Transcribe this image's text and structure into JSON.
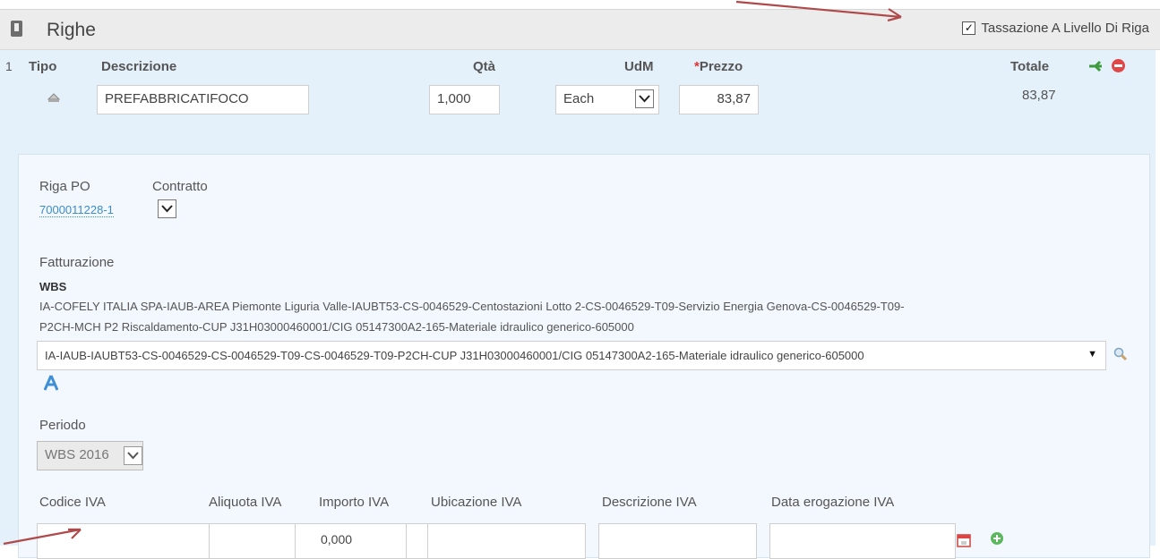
{
  "header": {
    "title": "Righe",
    "tax_label": "Tassazione A Livello Di Riga"
  },
  "line": {
    "number": "1",
    "columns": {
      "tipo": "Tipo",
      "descrizione": "Descrizione",
      "qta": "Qtà",
      "udm": "UdM",
      "prezzo_required": "*",
      "prezzo": "Prezzo",
      "totale": "Totale"
    },
    "description_value": "PREFABBRICATIFOCO",
    "qty_value": "1,000",
    "udm_value": "Each",
    "price_value": "83,87",
    "total_value": "83,87"
  },
  "details": {
    "riga_po_label": "Riga PO",
    "riga_po_value": "7000011228-1",
    "contratto_label": "Contratto",
    "fatturazione_label": "Fatturazione",
    "wbs_label": "WBS",
    "wbs_description_line1": "IA-COFELY ITALIA SPA-IAUB-AREA Piemonte Liguria Valle-IAUBT53-CS-0046529-Centostazioni Lotto 2-CS-0046529-T09-Servizio Energia Genova-CS-0046529-T09-",
    "wbs_description_line2": "P2CH-MCH P2 Riscaldamento-CUP J31H03000460001/CIG 05147300A2-165-Materiale idraulico generico-605000",
    "wbs_select_value": "IA-IAUB-IAUBT53-CS-0046529-CS-0046529-T09-CS-0046529-T09-P2CH-CUP J31H03000460001/CIG 05147300A2-165-Materiale idraulico generico-605000",
    "periodo_label": "Periodo",
    "periodo_value": "WBS 2016"
  },
  "iva": {
    "codice": "Codice IVA",
    "aliquota": "Aliquota IVA",
    "importo": "Importo IVA",
    "ubicazione": "Ubicazione IVA",
    "descrizione": "Descrizione IVA",
    "data": "Data erogazione IVA",
    "importo_value": "0,000"
  },
  "colors": {
    "accent_link": "#3b8ccc",
    "arrow": "#b04a4a",
    "panel": "#e4f0fa"
  }
}
